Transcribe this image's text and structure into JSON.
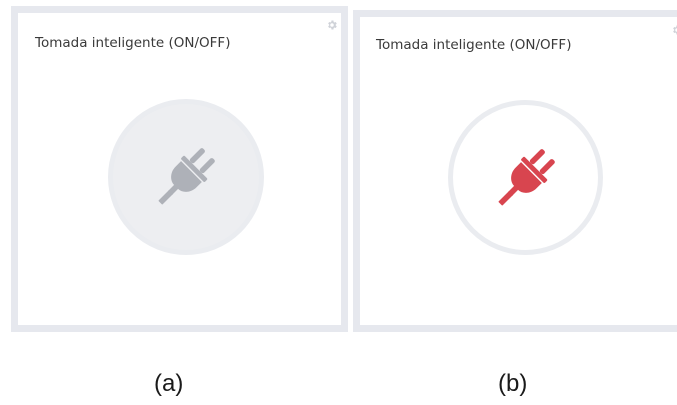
{
  "panels": [
    {
      "id": "a",
      "title": "Tomada inteligente (ON/OFF)",
      "state": "off",
      "plug_color": "#aeb1b8",
      "caption": "(a)"
    },
    {
      "id": "b",
      "title": "Tomada inteligente (ON/OFF)",
      "state": "on",
      "plug_color": "#d8454f",
      "caption": "(b)"
    }
  ],
  "icons": {
    "settings": "gear-icon",
    "device": "plug-icon"
  },
  "colors": {
    "panel_border": "#e6e8ee",
    "gear": "#cfd2d8"
  }
}
